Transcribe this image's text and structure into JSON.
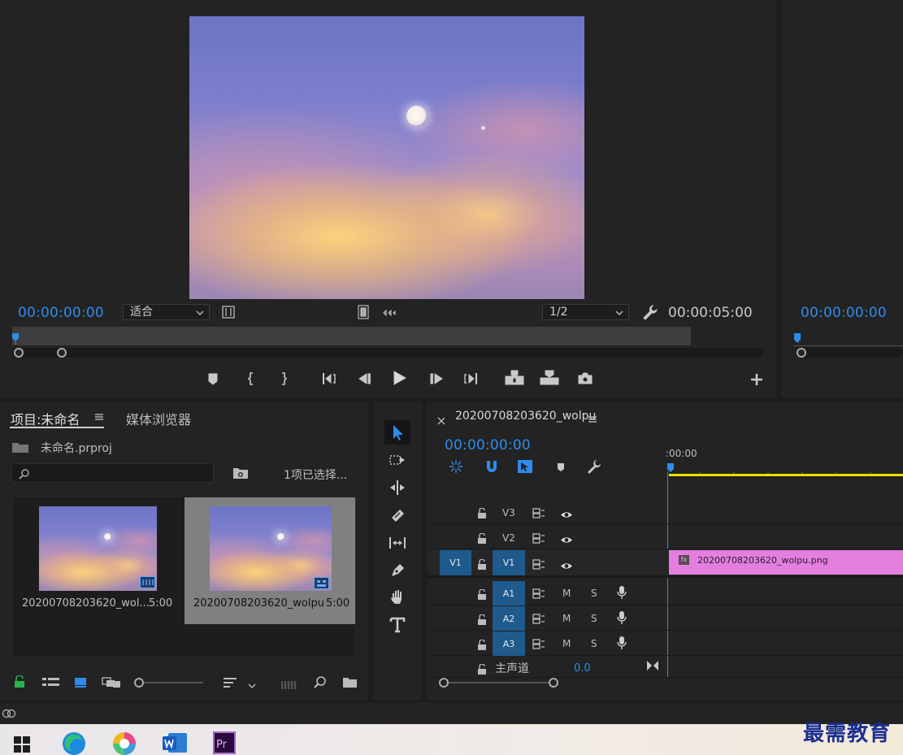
{
  "source_monitor": {
    "timecode_in": "00:00:00:00",
    "fit_label": "适合",
    "resolution_label": "1/2",
    "timecode_duration": "00:00:05:00"
  },
  "program_monitor": {
    "timecode": "00:00:00:00"
  },
  "project_panel": {
    "tab_project": "项目:未命名",
    "tab_media_browser": "媒体浏览器",
    "project_file": "未命名.prproj",
    "search_placeholder": "",
    "selection_status": "1项已选择...",
    "items": [
      {
        "name": "20200708203620_wol...",
        "duration": "5:00"
      },
      {
        "name": "20200708203620_wolpu",
        "duration": "5:00"
      }
    ]
  },
  "timeline": {
    "sequence_name": "20200708203620_wolpu",
    "timecode": "00:00:00:00",
    "ruler_label": ":00:00",
    "tracks": {
      "v3": "V3",
      "v2": "V2",
      "v1": "V1",
      "v1_source": "V1",
      "a1": "A1",
      "a2": "A2",
      "a3": "A3",
      "m": "M",
      "s": "S"
    },
    "master_label": "主声道",
    "master_value": "0.0",
    "clip_label": "20200708203620_wolpu.png",
    "clip_fx": "fx"
  },
  "watermark": "最需教育",
  "colors": {
    "accent_blue": "#2d8ceb",
    "clip_pink": "#e47fe0",
    "work_area_yellow": "#e6e000",
    "track_source_blue": "#1e5a8c"
  }
}
